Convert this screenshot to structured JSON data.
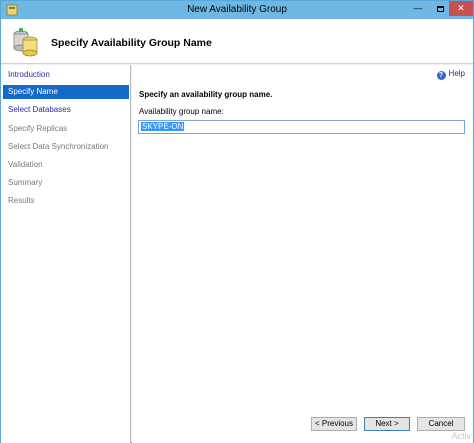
{
  "window": {
    "title": "New Availability Group",
    "min_symbol": "—",
    "close_symbol": "✕"
  },
  "header": {
    "title": "Specify Availability Group Name"
  },
  "nav": {
    "items": [
      {
        "label": "Introduction",
        "state": "link"
      },
      {
        "label": "Specify Name",
        "state": "active"
      },
      {
        "label": "Select Databases",
        "state": "link"
      },
      {
        "label": "Specify Replicas",
        "state": "disabled"
      },
      {
        "label": "Select Data Synchronization",
        "state": "disabled"
      },
      {
        "label": "Validation",
        "state": "disabled"
      },
      {
        "label": "Summary",
        "state": "disabled"
      },
      {
        "label": "Results",
        "state": "disabled"
      }
    ]
  },
  "content": {
    "help_label": "Help",
    "instruction": "Specify an availability group name.",
    "field_label": "Availability group name:",
    "field_value": "SKYPE-ON"
  },
  "buttons": {
    "previous": "< Previous",
    "next": "Next >",
    "cancel": "Cancel"
  },
  "watermark": "Activ",
  "colors": {
    "titlebar": "#6fb8e4",
    "nav_active": "#1468c7",
    "link": "#2a2aa8"
  }
}
